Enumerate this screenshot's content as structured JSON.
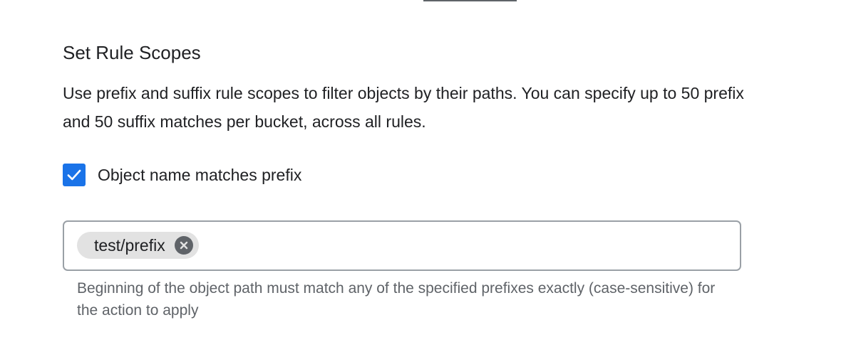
{
  "section": {
    "title": "Set Rule Scopes",
    "description": "Use prefix and suffix rule scopes to filter objects by their paths. You can specify up to 50 prefix and 50 suffix matches per bucket, across all rules."
  },
  "prefix_checkbox": {
    "label": "Object name matches prefix",
    "checked": true
  },
  "prefix_field": {
    "chips": [
      {
        "label": "test/prefix"
      }
    ],
    "helper_text": "Beginning of the object path must match any of the specified prefixes exactly (case-sensitive) for the action to apply"
  },
  "icons": {
    "checkbox": "check-icon",
    "chip_remove": "cancel-icon"
  },
  "colors": {
    "accent": "#1a73e8",
    "text_primary": "#202124",
    "text_secondary": "#5f6368",
    "field_border": "#9aa0a6",
    "chip_background": "#e2e2e2"
  }
}
